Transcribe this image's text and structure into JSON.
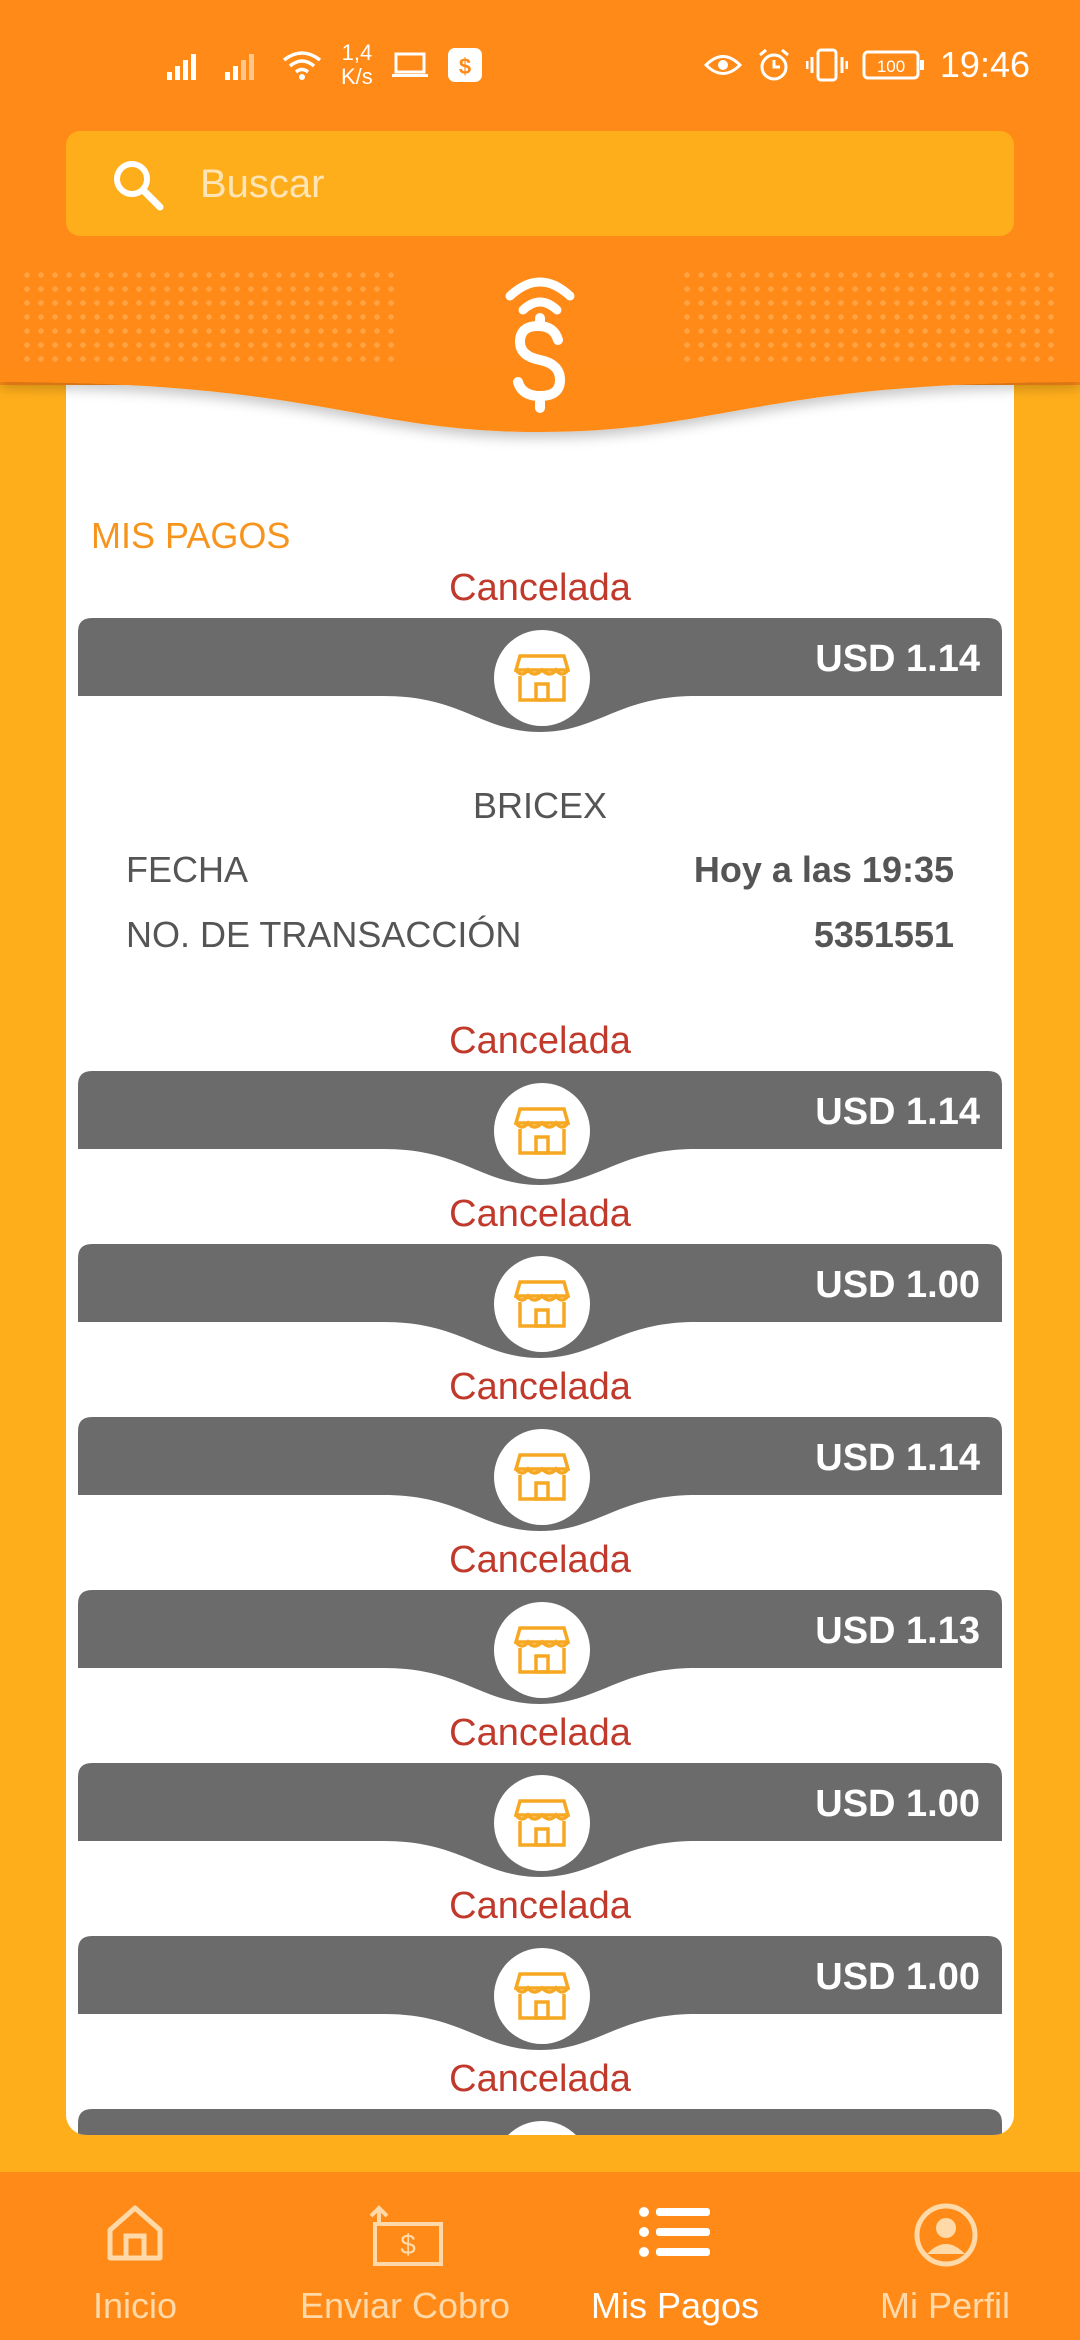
{
  "statusbar": {
    "speed_top": "1,4",
    "speed_bottom": "K/s",
    "battery": "100",
    "time": "19:46"
  },
  "search": {
    "placeholder": "Buscar"
  },
  "section_title": "MIS PAGOS",
  "expanded": {
    "status": "Cancelada",
    "amount": "USD 1.14",
    "merchant": "BRICEX",
    "date_label": "FECHA",
    "date_value": "Hoy a las 19:35",
    "tx_label": "NO. DE TRANSACCIÓN",
    "tx_value": "5351551"
  },
  "payments": [
    {
      "status": "Cancelada",
      "amount": "USD 1.14"
    },
    {
      "status": "Cancelada",
      "amount": "USD 1.00"
    },
    {
      "status": "Cancelada",
      "amount": "USD 1.14"
    },
    {
      "status": "Cancelada",
      "amount": "USD 1.13"
    },
    {
      "status": "Cancelada",
      "amount": "USD 1.00"
    },
    {
      "status": "Cancelada",
      "amount": "USD 1.00"
    },
    {
      "status": "Cancelada",
      "amount": ""
    }
  ],
  "nav": [
    {
      "label": "Inicio",
      "icon": "home-icon"
    },
    {
      "label": "Enviar Cobro",
      "icon": "send-payment-icon"
    },
    {
      "label": "Mis Pagos",
      "icon": "list-icon",
      "active": true
    },
    {
      "label": "Mi Perfil",
      "icon": "profile-icon"
    }
  ],
  "colors": {
    "header": "#FF8A17",
    "background": "#FFAE1B",
    "bar": "#6B6B6B",
    "status": "#C0392B",
    "accent": "#F7941D"
  }
}
